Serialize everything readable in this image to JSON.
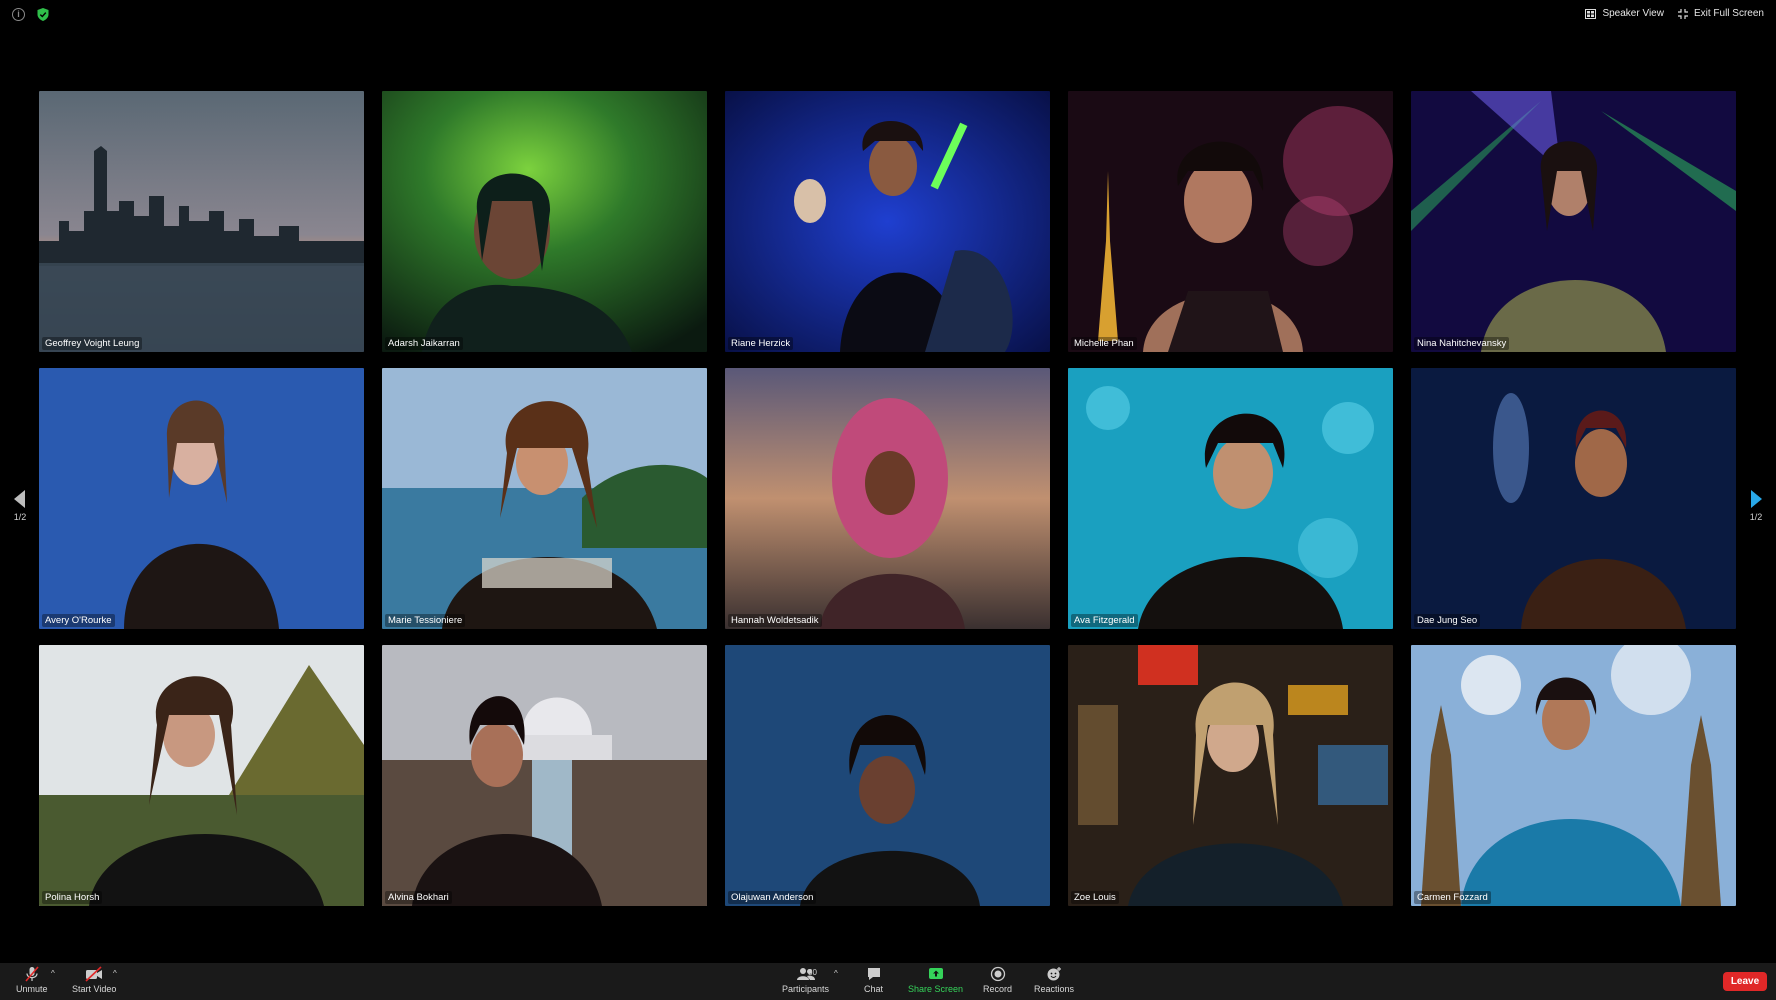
{
  "top_bar": {
    "speaker_view_label": "Speaker View",
    "exit_full_screen_label": "Exit Full Screen"
  },
  "pagination": {
    "left_label": "1/2",
    "right_label": "1/2"
  },
  "participants": [
    {
      "name": "Geoffrey Voight Leung"
    },
    {
      "name": "Adarsh Jaikarran"
    },
    {
      "name": "Riane Herzick"
    },
    {
      "name": "Michelle Phan"
    },
    {
      "name": "Nina Nahitchevansky"
    },
    {
      "name": "Avery O'Rourke"
    },
    {
      "name": "Marie Tessioniere"
    },
    {
      "name": "Hannah Woldetsadik"
    },
    {
      "name": "Ava Fitzgerald"
    },
    {
      "name": "Dae Jung Seo"
    },
    {
      "name": "Polina Horsh"
    },
    {
      "name": "Alvina Bokhari"
    },
    {
      "name": "Olajuwan Anderson"
    },
    {
      "name": "Zoe Louis"
    },
    {
      "name": "Carmen Fozzard"
    }
  ],
  "toolbar": {
    "unmute_label": "Unmute",
    "start_video_label": "Start Video",
    "participants_label": "Participants",
    "participants_count": "30",
    "chat_label": "Chat",
    "share_screen_label": "Share Screen",
    "record_label": "Record",
    "reactions_label": "Reactions",
    "leave_label": "Leave"
  },
  "colors": {
    "background": "#000000",
    "toolbar_bg": "#1a1a1a",
    "share_green": "#35d35a",
    "leave_red": "#e02828"
  }
}
